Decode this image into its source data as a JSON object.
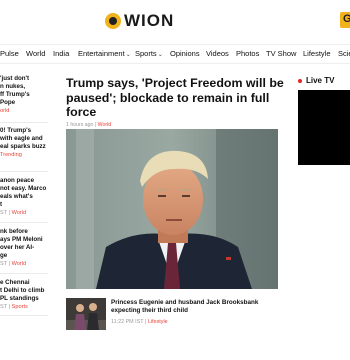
{
  "brand": {
    "name": "WION",
    "corner_badge": "G"
  },
  "nav": {
    "items": [
      {
        "label": "Pulse",
        "dropdown": false
      },
      {
        "label": "World",
        "dropdown": false
      },
      {
        "label": "India",
        "dropdown": false
      },
      {
        "label": "Entertainment",
        "dropdown": true
      },
      {
        "label": "Sports",
        "dropdown": true
      },
      {
        "label": "Opinions",
        "dropdown": false
      },
      {
        "label": "Videos",
        "dropdown": false
      },
      {
        "label": "Photos",
        "dropdown": false
      },
      {
        "label": "TV Show",
        "dropdown": false
      },
      {
        "label": "Lifestyle",
        "dropdown": false
      },
      {
        "label": "Scie",
        "dropdown": false
      }
    ]
  },
  "sidebar": {
    "items": [
      {
        "text": "'just don't\nn nukes,\nff Trump's\nPope",
        "category": "orld"
      },
      {
        "text": "0! Trump's\nwith eagle and\neal sparks buzz",
        "category": "Trending"
      },
      {
        "text": "anon peace\nnot easy. Marco\neals what's\nt",
        "time": "ST |",
        "category": "World"
      },
      {
        "text": "nk before\nays PM Meloni\nover her AI-\nge",
        "time": "ST |",
        "category": "World"
      },
      {
        "text": "e Chennai\nt Delhi to climb\nPL standings",
        "time": "ST |",
        "category": "Sports"
      }
    ]
  },
  "article": {
    "headline": "Trump says, 'Project Freedom will be paused'; blockade to remain in full force",
    "time": "1 hours ago",
    "category": "World",
    "image_alt": "Donald Trump"
  },
  "related": {
    "title": "Princess Eugenie and husband Jack Brooksbank expecting their third child",
    "time": "11:22 PM IST",
    "category": "Lifestyle"
  },
  "live": {
    "label": "Live TV"
  },
  "colors": {
    "accent": "#e8443a",
    "live_dot": "#e8262a",
    "logo": "#f2b21c"
  }
}
